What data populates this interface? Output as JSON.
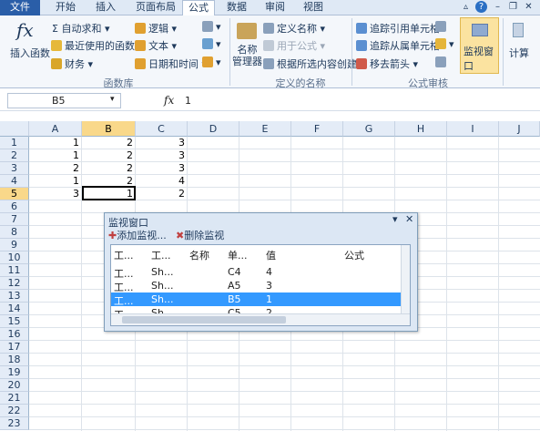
{
  "tabs": [
    {
      "label": "文件"
    },
    {
      "label": "开始"
    },
    {
      "label": "插入"
    },
    {
      "label": "页面布局"
    },
    {
      "label": "公式"
    },
    {
      "label": "数据"
    },
    {
      "label": "审阅"
    },
    {
      "label": "视图"
    }
  ],
  "ribbon": {
    "insert_function": "插入函数",
    "autosum": "Σ 自动求和 ▾",
    "recent": "最近使用的函数 ▾",
    "finance": "财务 ▾",
    "logic": "逻辑 ▾",
    "text": "文本 ▾",
    "datetime": "日期和时间 ▾",
    "group_library": "函数库",
    "name_manager": "名称\n管理器",
    "define_name": "定义名称 ▾",
    "use_in_formula": "用于公式 ▾",
    "create_from_selection": "根据所选内容创建",
    "group_names": "定义的名称",
    "trace_precedents": "追踪引用单元格",
    "trace_dependents": "追踪从属单元格",
    "remove_arrows": "移去箭头 ▾",
    "group_audit": "公式审核",
    "watch_window": "监视窗口",
    "calculate": "计算"
  },
  "formula_bar": {
    "name_box": "B5",
    "fx": "fx",
    "value": "1"
  },
  "columns": [
    "A",
    "B",
    "C",
    "D",
    "E",
    "F",
    "G",
    "H",
    "I",
    "J"
  ],
  "rows": [
    "1",
    "2",
    "3",
    "4",
    "5",
    "6",
    "7",
    "8",
    "9",
    "10",
    "11",
    "12",
    "13",
    "14",
    "15",
    "16",
    "17",
    "18",
    "19",
    "20",
    "21",
    "22",
    "23"
  ],
  "cells": {
    "A": [
      "1",
      "1",
      "2",
      "1",
      "3"
    ],
    "B": [
      "2",
      "2",
      "2",
      "2",
      "1"
    ],
    "C": [
      "3",
      "3",
      "3",
      "4",
      "2"
    ]
  },
  "watch": {
    "title": "监视窗口",
    "add": "添加监视...",
    "delete": "删除监视",
    "headers": [
      "工...",
      "工...",
      "名称",
      "单...",
      "值",
      "公式"
    ],
    "rows": [
      [
        "工...",
        "Sh...",
        "",
        "C4",
        "4",
        ""
      ],
      [
        "工...",
        "Sh...",
        "",
        "A5",
        "3",
        ""
      ],
      [
        "工...",
        "Sh...",
        "",
        "B5",
        "1",
        ""
      ],
      [
        "工...",
        "Sh...",
        "",
        "C5",
        "2",
        ""
      ]
    ]
  },
  "colors": {
    "accent": "#2a5ea8",
    "selected_row": "#3399ff",
    "selected_header": "#f9d88a"
  }
}
